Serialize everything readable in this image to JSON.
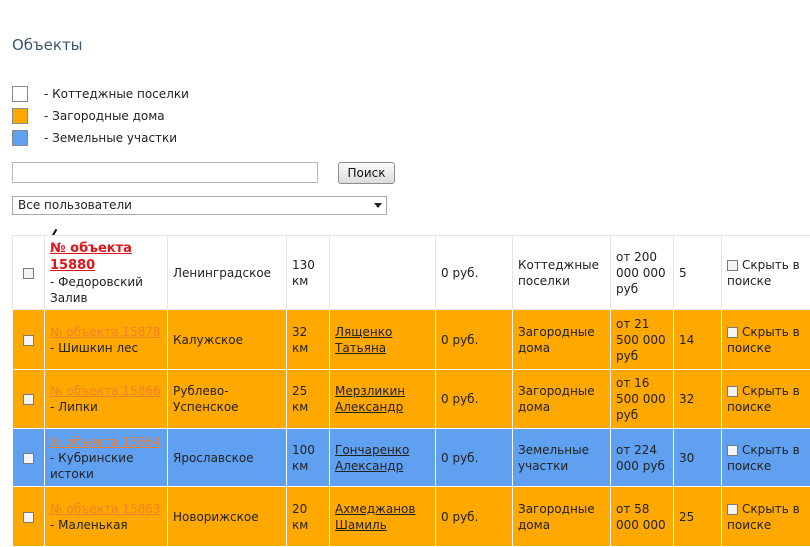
{
  "page": {
    "title": "Объекты"
  },
  "legend": [
    {
      "label": "- Коттеджные поселки",
      "color": "#ffffff"
    },
    {
      "label": "- Загородные дома",
      "color": "#ffa800"
    },
    {
      "label": "- Земельные участки",
      "color": "#60a0f0"
    }
  ],
  "search": {
    "placeholder": "",
    "value": "",
    "button_label": "Поиск"
  },
  "user_filter": {
    "selected": "Все пользователи"
  },
  "table": {
    "hide_label": "Скрыть в поиске",
    "rows": [
      {
        "type": "white",
        "object": "№ объекта 15880",
        "name": "- Федоровский Залив",
        "direction": "Ленинградское",
        "distance": "130 км",
        "contact": "",
        "price": "0 руб.",
        "category": "Коттеджные поселки",
        "range": "от 200 000 000 руб",
        "count": "5"
      },
      {
        "type": "orange",
        "object": "№ объекта 15878",
        "name": "- Шишкин лес",
        "direction": "Калужское",
        "distance": "32 км",
        "contact": "Лященко Татьяна",
        "price": "0 руб.",
        "category": "Загородные дома",
        "range": "от 21 500 000 руб",
        "count": "14"
      },
      {
        "type": "orange",
        "object": "№ объекта 15866",
        "name": "- Липки",
        "direction": "Рублево-Успенское",
        "distance": "25 км",
        "contact": "Мерзликин Александр",
        "price": "0 руб.",
        "category": "Загородные дома",
        "range": "от 16 500 000 руб",
        "count": "32"
      },
      {
        "type": "blue",
        "object": "№ объекта 15864",
        "name": "- Кубринские истоки",
        "direction": "Ярославское",
        "distance": "100 км",
        "contact": "Гончаренко Александр",
        "price": "0 руб.",
        "category": "Земельные участки",
        "range": "от 224 000 руб",
        "count": "30"
      },
      {
        "type": "orange",
        "object": "№ объекта 15863",
        "name": "- Маленькая",
        "direction": "Новорижское",
        "distance": "20 км",
        "contact": "Ахмеджанов Шамиль",
        "price": "0 руб.",
        "category": "Загородные дома",
        "range": "от 58 000 000",
        "count": "25"
      }
    ]
  }
}
